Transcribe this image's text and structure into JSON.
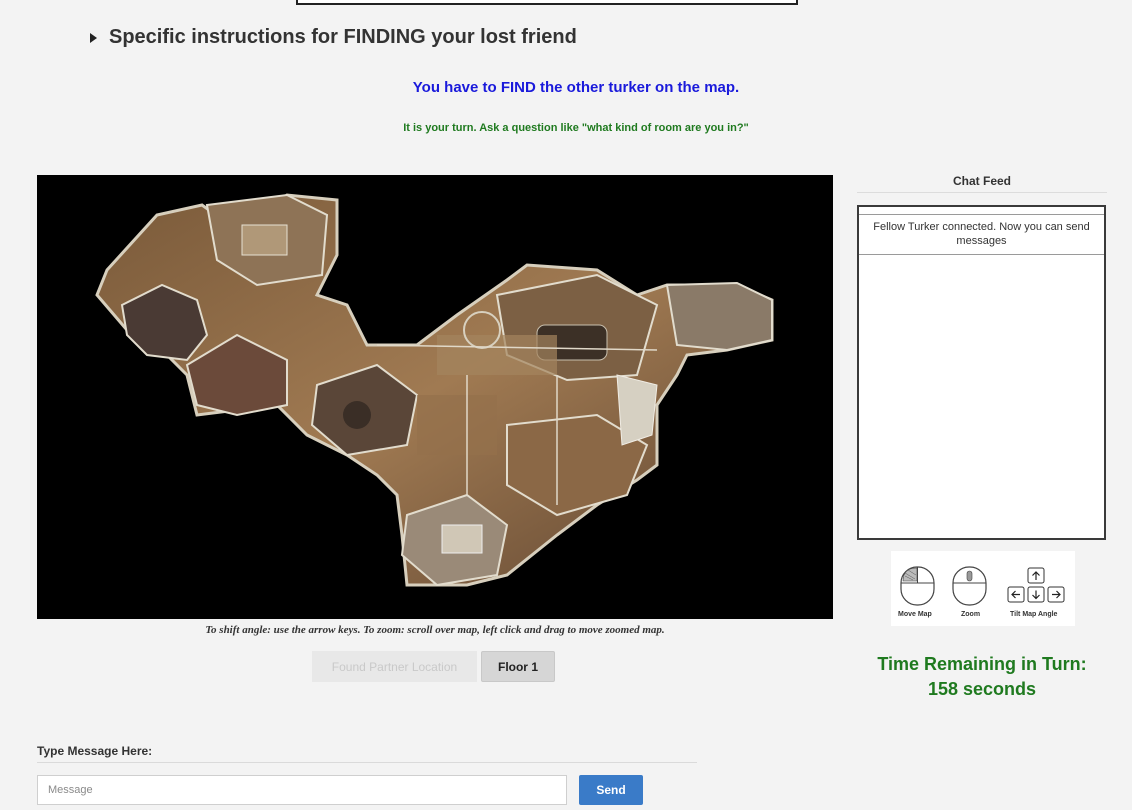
{
  "header": {
    "instructions_title": "Specific instructions for FINDING your lost friend",
    "goal_text": "You have to FIND the other turker on the map.",
    "turn_text": "It is your turn. Ask a question like \"what kind of room are you in?\""
  },
  "map": {
    "caption": "To shift angle: use the arrow keys. To zoom: scroll over map, left click and drag to move zoomed map.",
    "found_button_label": "Found Partner Location",
    "floor_button_label": "Floor 1"
  },
  "message": {
    "label": "Type Message Here:",
    "placeholder": "Message",
    "value": "",
    "send_label": "Send"
  },
  "chat": {
    "title": "Chat Feed",
    "messages": [
      "Fellow Turker connected. Now you can send messages"
    ]
  },
  "controls_legend": {
    "move_label": "Move Map",
    "zoom_label": "Zoom",
    "tilt_label": "Tilt Map Angle",
    "icons": [
      "mouse-left-click-icon",
      "mouse-scroll-icon",
      "arrow-keys-icon"
    ]
  },
  "timer": {
    "line1": "Time Remaining in Turn:",
    "line2": "158 seconds"
  },
  "colors": {
    "goal": "#1a1adb",
    "turn": "#1f7a1f",
    "timer": "#1f7a1f",
    "send_button": "#3a7bc8"
  }
}
